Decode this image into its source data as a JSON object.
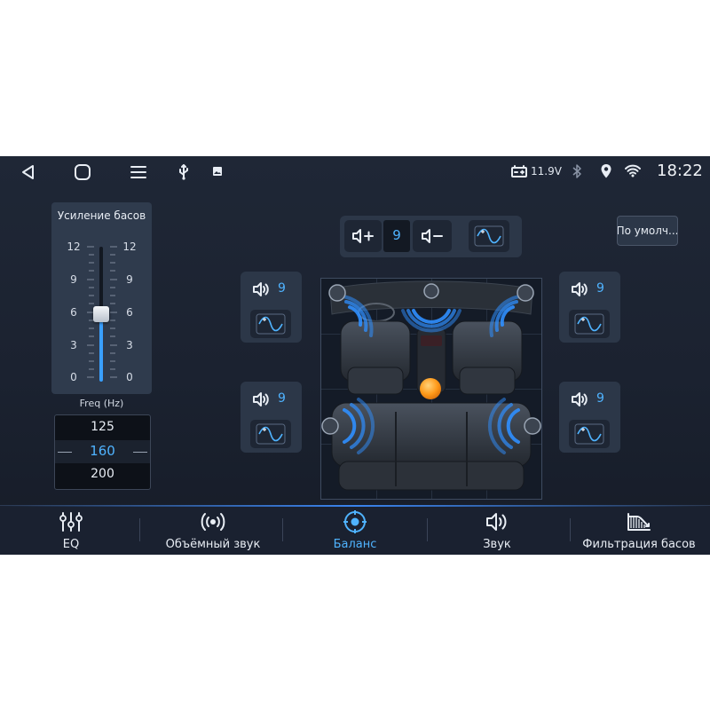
{
  "status_bar": {
    "battery_voltage": "11.9V",
    "time": "18:22",
    "icons": [
      "back-icon",
      "home-icon",
      "menu-icon",
      "usb-icon",
      "image-icon",
      "battery-icon",
      "bluetooth-icon",
      "location-icon",
      "wifi-icon"
    ]
  },
  "bass_boost": {
    "title": "Усиление басов",
    "scale": [
      "12",
      "9",
      "6",
      "3",
      "0"
    ],
    "level": 6,
    "max": 12,
    "freq_label": "Freq (Hz)",
    "freq_options": [
      "125",
      "160",
      "200"
    ],
    "freq_selected": "160"
  },
  "balance": {
    "master_volume": "9",
    "speakers": {
      "front_left": "9",
      "front_right": "9",
      "rear_left": "9",
      "rear_right": "9"
    }
  },
  "default_button": "По умолч...",
  "nav": {
    "items": [
      {
        "label": "EQ",
        "icon": "eq-sliders-icon"
      },
      {
        "label": "Объёмный звук",
        "icon": "surround-icon"
      },
      {
        "label": "Баланс",
        "icon": "balance-target-icon"
      },
      {
        "label": "Звук",
        "icon": "speaker-icon"
      },
      {
        "label": "Фильтрация басов",
        "icon": "bass-filter-icon"
      }
    ],
    "active": "Баланс"
  },
  "colors": {
    "accent": "#4fb3ff",
    "background": "#1f2736",
    "panel": "#2f3b4d",
    "focus_point": "#ff9a1a"
  }
}
